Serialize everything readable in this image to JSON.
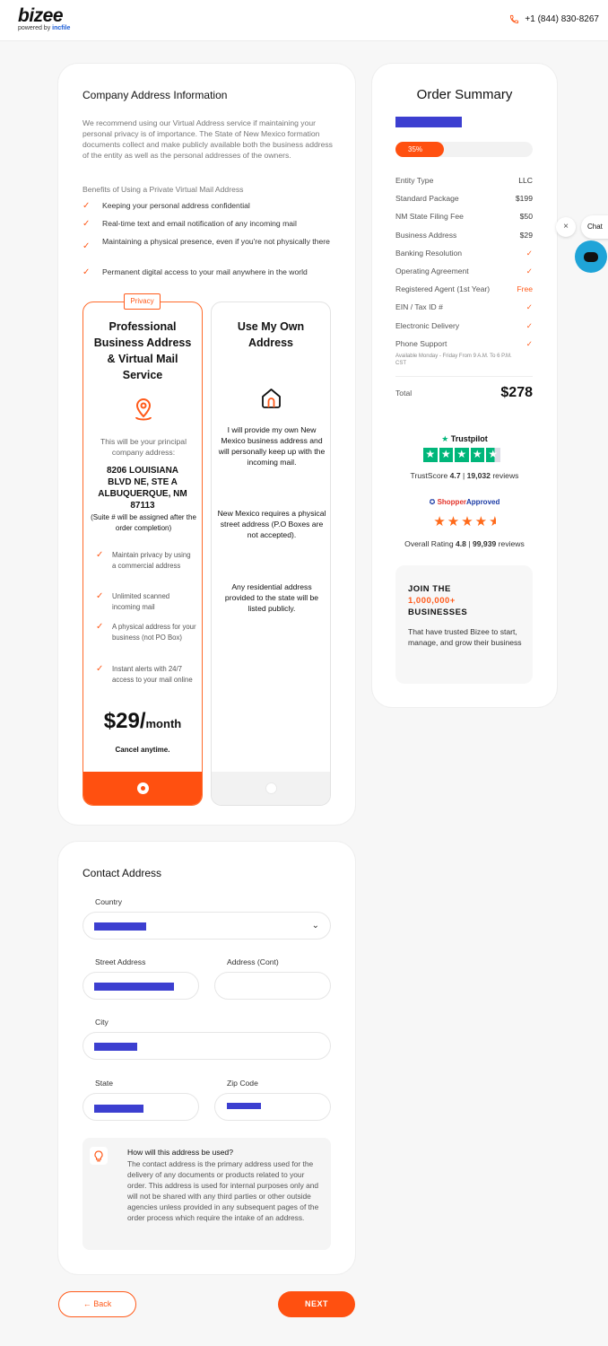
{
  "header": {
    "logo": "bizee",
    "logo_sub_prefix": "powered by",
    "logo_sub_brand": "incfile",
    "phone": "+1 (844) 830-8267"
  },
  "company": {
    "title": "Company Address Information",
    "intro": "We recommend using our Virtual Address service if maintaining your personal privacy is of importance. The State of New Mexico formation documents collect and make publicly available both the business address of the entity as well as the personal addresses of the owners.",
    "benefits_title": "Benefits of Using a Private Virtual Mail Address",
    "benefits": [
      "Keeping your personal address confidential",
      "Real-time text and email notification of any incoming mail",
      "Maintaining a physical presence, even if you're not physically there",
      "Permanent digital access to your mail anywhere in the world"
    ],
    "professional": {
      "badge": "Privacy",
      "title": "Professional Business Address & Virtual Mail Service",
      "principal_note": "This will be your principal company address:",
      "address_line1": "8206 LOUISIANA",
      "address_line2": "BLVD NE, STE A",
      "address_line3": "ALBUQUERQUE, NM",
      "address_line4": "87113",
      "suite_note": "(Suite # will be assigned after the order completion)",
      "features": [
        "Maintain privacy by using a commercial address",
        "Unlimited scanned incoming mail",
        "A physical address for your business (not PO Box)",
        "Instant alerts with 24/7 access to your mail online"
      ],
      "price": "$29/",
      "price_unit": "month",
      "cancel": "Cancel anytime."
    },
    "own": {
      "title": "Use My Own Address",
      "desc1": "I will provide my own New Mexico business address and will personally keep up with the incoming mail.",
      "desc2": "New Mexico requires a physical street address (P.O Boxes are not accepted).",
      "desc3": "Any residential address provided to the state will be listed publicly."
    }
  },
  "summary": {
    "title": "Order Summary",
    "progress_label": "35%",
    "progress_value": 0.35,
    "rows": [
      {
        "label": "Entity Type",
        "value": "LLC"
      },
      {
        "label": "Standard Package",
        "value": "$199"
      },
      {
        "label": "NM State Filing Fee",
        "value": "$50"
      },
      {
        "label": "Business Address",
        "value": "$29"
      },
      {
        "label": "Banking Resolution",
        "value": "✓"
      },
      {
        "label": "Operating Agreement",
        "value": "✓"
      },
      {
        "label": "Registered Agent (1st Year)",
        "value": "Free"
      },
      {
        "label": "EIN / Tax ID #",
        "value": "✓"
      },
      {
        "label": "Electronic Delivery",
        "value": "✓"
      },
      {
        "label": "Phone Support",
        "value": "✓"
      }
    ],
    "support_note": "Available Monday - Friday From 9 A.M. To 6 P.M. CST",
    "total_label": "Total",
    "total_value": "$278",
    "trustpilot_label": "Trustpilot",
    "trust_score_text": "TrustScore",
    "trust_score": "4.7",
    "trust_reviews": "19,032",
    "reviews_word": "reviews",
    "shopper_a": "Shopper",
    "shopper_b": "Approved",
    "overall_text": "Overall Rating",
    "overall_score": "4.8",
    "overall_reviews": "99,939",
    "join_1": "JOIN THE",
    "join_2": "1,000,000+",
    "join_3": "BUSINESSES",
    "join_text": "That have trusted Bizee to start, manage, and grow their business"
  },
  "contact": {
    "title": "Contact Address",
    "country_label": "Country",
    "street_label": "Street Address",
    "address_cont_label": "Address (Cont)",
    "city_label": "City",
    "state_label": "State",
    "zip_label": "Zip Code",
    "hint_title": "How will this address be used?",
    "hint_text": "The contact address is the primary address used for the delivery of any documents or products related to your order. This address is used for internal purposes only and will not be shared with any third parties or other outside agencies unless provided in any subsequent pages of the order process which require the intake of an address."
  },
  "nav": {
    "back": "← Back",
    "next": "NEXT"
  },
  "chat": {
    "label": "Chat",
    "close": "×"
  },
  "colors": {
    "accent": "#ff5010",
    "trustpilot": "#00b67a",
    "redaction": "#3c3fd0",
    "chat": "#1fa4d8"
  }
}
